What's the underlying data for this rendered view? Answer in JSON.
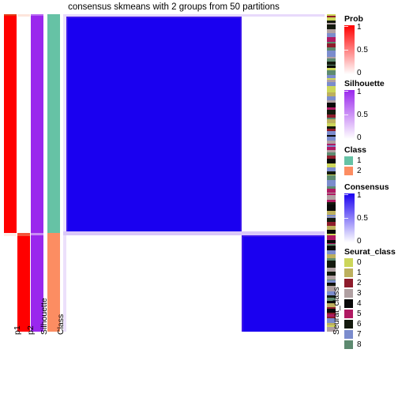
{
  "title": "consensus skmeans with 2 groups from 50 partitions",
  "row_labels": {
    "p1": "p1",
    "p2": "p2",
    "silhouette": "Silhouette",
    "class": "Class",
    "seurat_class": "Seurat_class"
  },
  "legends": {
    "prob": {
      "title": "Prob",
      "type": "continuous",
      "ticks": [
        "1",
        "0.5",
        "0"
      ],
      "low_color": "#ffffff",
      "high_color": "#ff0000"
    },
    "silhouette": {
      "title": "Silhouette",
      "type": "continuous",
      "ticks": [
        "1",
        "0.5",
        "0"
      ],
      "low_color": "#ffffff",
      "high_color": "#9a28ed"
    },
    "class": {
      "title": "Class",
      "type": "discrete",
      "items": [
        {
          "label": "1",
          "color": "#66c2a5"
        },
        {
          "label": "2",
          "color": "#fc8d62"
        }
      ]
    },
    "consensus": {
      "title": "Consensus",
      "type": "continuous",
      "ticks": [
        "1",
        "0.5",
        "0"
      ],
      "low_color": "#ffffff",
      "high_color": "#1a00f0"
    },
    "seurat_class": {
      "title": "Seurat_class",
      "type": "discrete",
      "items": [
        {
          "label": "0",
          "color": "#ccd65a"
        },
        {
          "label": "1",
          "color": "#bdb05e"
        },
        {
          "label": "2",
          "color": "#8e1c2c"
        },
        {
          "label": "3",
          "color": "#b0a0a2"
        },
        {
          "label": "4",
          "color": "#0a0a0a"
        },
        {
          "label": "5",
          "color": "#b01a63"
        },
        {
          "label": "6",
          "color": "#141a0e"
        },
        {
          "label": "7",
          "color": "#7b8ccd"
        },
        {
          "label": "8",
          "color": "#5d8a70"
        }
      ]
    }
  },
  "chart_data": {
    "type": "heatmap",
    "title": "consensus skmeans with 2 groups from 50 partitions",
    "n_groups": 2,
    "n_partitions": 50,
    "method": "skmeans",
    "row_split_fraction": 0.685,
    "col_split_fraction": 0.685,
    "matrix_description": "Block-diagonal consensus matrix: group 1 (upper-left, ~68.5% of samples) and group 2 (lower-right, ~31.5%) both at consensus 1 (blue); off-diagonal blocks at consensus 0 (white).",
    "blocks": [
      {
        "group": 1,
        "x0": 0.0,
        "x1": 0.685,
        "y0": 0.0,
        "y1": 0.685,
        "consensus": 1
      },
      {
        "group": 2,
        "x0": 0.685,
        "x1": 1.0,
        "y0": 0.685,
        "y1": 1.0,
        "consensus": 1
      },
      {
        "group": "1-2",
        "x0": 0.685,
        "x1": 1.0,
        "y0": 0.0,
        "y1": 0.685,
        "consensus": 0
      },
      {
        "group": "2-1",
        "x0": 0.0,
        "x1": 0.685,
        "y0": 0.685,
        "y1": 1.0,
        "consensus": 0
      }
    ],
    "annotations": [
      {
        "name": "p1",
        "type": "continuous",
        "group1_value": 1,
        "group2_value": 0,
        "colors": [
          "#ffffff",
          "#ff0000"
        ]
      },
      {
        "name": "p2",
        "type": "continuous",
        "group1_value": 0,
        "group2_value": 1,
        "colors": [
          "#ffffff",
          "#ff0000"
        ]
      },
      {
        "name": "Silhouette",
        "type": "continuous",
        "group1_value": 1,
        "group2_value": 1,
        "colors": [
          "#ffffff",
          "#9a28ed"
        ]
      },
      {
        "name": "Class",
        "type": "discrete",
        "group1_value": "1",
        "group2_value": "2",
        "colors": [
          "#66c2a5",
          "#fc8d62"
        ]
      },
      {
        "name": "Seurat_class",
        "type": "discrete",
        "n_levels": 9,
        "levels": [
          "0",
          "1",
          "2",
          "3",
          "4",
          "5",
          "6",
          "7",
          "8"
        ]
      }
    ]
  }
}
